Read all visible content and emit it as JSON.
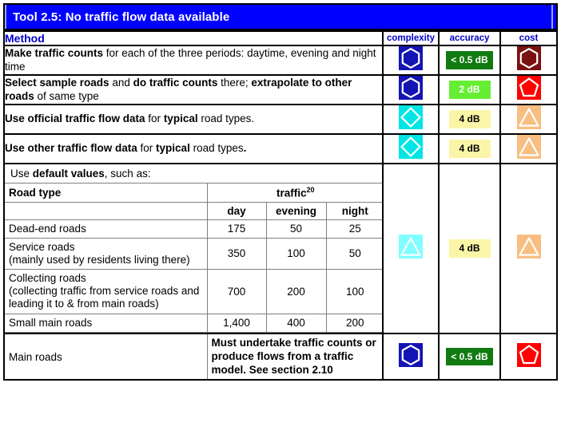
{
  "title": {
    "text": "Tool 2.5: No traffic flow data available",
    "bg_color": "#0000FF",
    "text_color": "#FFFFFF"
  },
  "columns": {
    "method": "Method",
    "complexity": "complexity",
    "accuracy": "accuracy",
    "cost": "cost",
    "header_color": "#0000CC"
  },
  "rows": [
    {
      "method_html": "<b>Make traffic counts</b> for each of the three periods: daytime, evening and night time",
      "complexity_icon": "hexagon-icon",
      "complexity_bg": "#1414B4",
      "accuracy_label": "< 0.5 dB",
      "accuracy_style": "db-dark",
      "cost_icon": "hexagon-icon",
      "cost_bg": "#7B1010"
    },
    {
      "method_html": "<b>Select sample roads</b> and <b>do traffic counts</b> there; <b>extrapolate to other roads</b> of same type",
      "complexity_icon": "hexagon-icon",
      "complexity_bg": "#1414B4",
      "accuracy_label": "2 dB",
      "accuracy_style": "db-light",
      "cost_icon": "pentagon-icon",
      "cost_bg": "#FF0000"
    },
    {
      "method_html": "<b>Use official traffic flow data</b> for <b>typical</b> road types.",
      "complexity_icon": "diamond-icon",
      "complexity_bg": "#00E5E5",
      "accuracy_label": "4 dB",
      "accuracy_style": "db-yellow",
      "cost_icon": "triangle-icon",
      "cost_bg": "#F8BE81"
    },
    {
      "method_html": "<b>Use other traffic flow data</b> for <b>typical</b> road types<b>.</b>",
      "complexity_icon": "diamond-icon",
      "complexity_bg": "#00E5E5",
      "accuracy_label": "4 dB",
      "accuracy_style": "db-yellow",
      "cost_icon": "triangle-icon",
      "cost_bg": "#F8BE81"
    }
  ],
  "defaults_block": {
    "intro_html": "Use <b>default values</b>, such as:",
    "complexity_icon": "triangle-icon",
    "complexity_bg": "#7FFFFF",
    "accuracy_label": "4 dB",
    "accuracy_style": "db-yellow",
    "cost_icon": "triangle-icon",
    "cost_bg": "#F8BE81",
    "inner_table": {
      "road_type_header": "Road type",
      "traffic_header": "traffic",
      "traffic_superscript": "20",
      "period_headers": [
        "day",
        "evening",
        "night"
      ],
      "rows": [
        {
          "road_type": "Dead-end roads",
          "day": "175",
          "evening": "50",
          "night": "25"
        },
        {
          "road_type": "Service roads\n(mainly used by residents living there)",
          "day": "350",
          "evening": "100",
          "night": "50"
        },
        {
          "road_type": "Collecting roads\n(collecting traffic from service roads and leading it to & from main roads)",
          "day": "700",
          "evening": "200",
          "night": "100"
        },
        {
          "road_type": "Small main roads",
          "day": "1,400",
          "evening": "400",
          "night": "200"
        }
      ]
    }
  },
  "main_roads_block": {
    "label": "Main roads",
    "note": "Must undertake traffic counts or produce flows from a traffic model. See section 2.10",
    "complexity_icon": "hexagon-icon",
    "complexity_bg": "#1414B4",
    "accuracy_label": "< 0.5 dB",
    "accuracy_style": "db-dark",
    "cost_icon": "pentagon-icon",
    "cost_bg": "#FF0000"
  }
}
